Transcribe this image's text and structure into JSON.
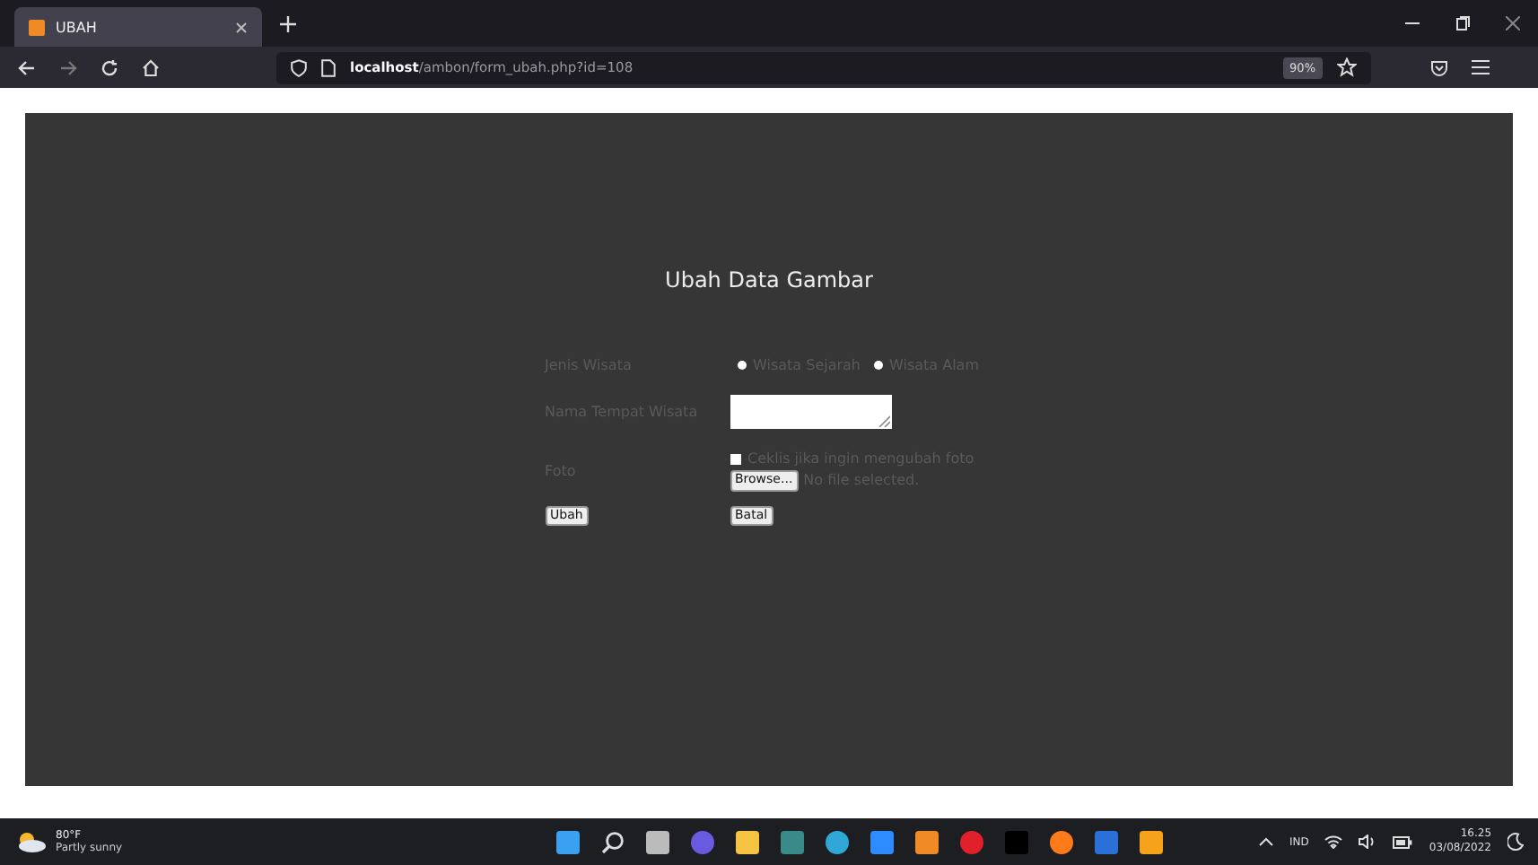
{
  "browser": {
    "tab": {
      "title": "UBAH",
      "selected": true
    },
    "address": {
      "host": "localhost",
      "path": "/ambon/form_ubah.php?id=108"
    },
    "zoom": "90%"
  },
  "form": {
    "title": "Ubah Data Gambar",
    "jenis": {
      "label": "Jenis Wisata",
      "options": [
        {
          "label": "Wisata Sejarah",
          "selected": false
        },
        {
          "label": "Wisata Alam",
          "selected": false
        }
      ]
    },
    "nama": {
      "label": "Nama Tempat Wisata"
    },
    "foto": {
      "label": "Foto",
      "checkbox": {
        "label": "Ceklis jika ingin mengubah foto",
        "checked": false
      },
      "browse": "Browse...",
      "file_status": "No file selected."
    },
    "buttons": [
      "Ubah",
      "Batal"
    ]
  },
  "taskbar": {
    "weather": {
      "temp": "80°F",
      "condition": "Partly sunny"
    },
    "language": "IND",
    "time": "16.25",
    "date": "03/08/2022"
  }
}
